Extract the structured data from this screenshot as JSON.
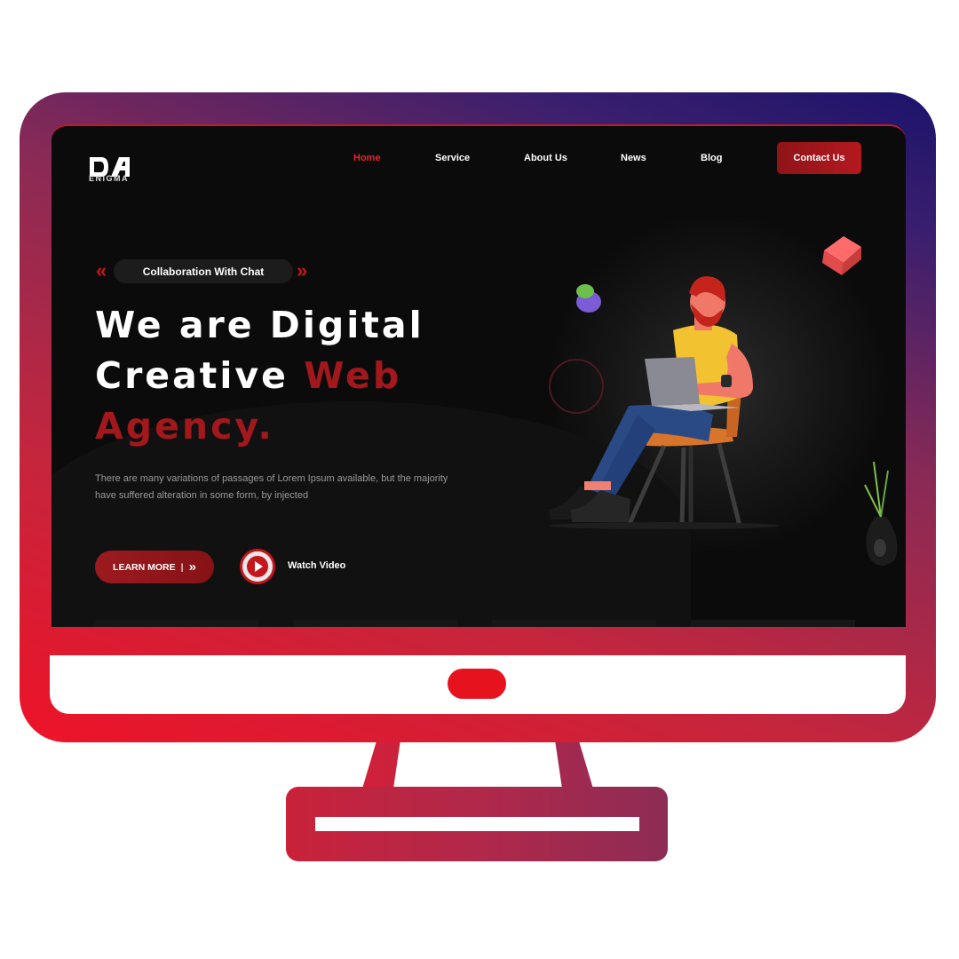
{
  "brand": {
    "logo_mark": "DA",
    "name": "ENIGMA"
  },
  "nav": {
    "items": [
      {
        "label": "Home",
        "active": true
      },
      {
        "label": "Service",
        "active": false
      },
      {
        "label": "About Us",
        "active": false
      },
      {
        "label": "News",
        "active": false
      },
      {
        "label": "Blog",
        "active": false
      }
    ],
    "contact_label": "Contact Us"
  },
  "hero": {
    "tag": "Collaboration With Chat",
    "headline_line1": "We are Digital",
    "headline_line2_white": "Creative ",
    "headline_line2_red": "Web",
    "headline_line3_red": "Agency.",
    "description": "There are many variations of passages of Lorem Ipsum available, but the majority have suffered alteration in some form, by injected",
    "learn_more_label": "LEARN MORE",
    "learn_more_icon": "double-chevron-right-icon",
    "watch_video_label": "Watch Video",
    "play_icon": "play-icon"
  },
  "illustration": "man-with-laptop-on-chair",
  "colors": {
    "accent": "#c4161c",
    "accent_dark": "#8e1418",
    "screen_bg": "#0b0b0b",
    "frame_gradient_start": "#ee1328",
    "frame_gradient_end": "#1c136b"
  }
}
